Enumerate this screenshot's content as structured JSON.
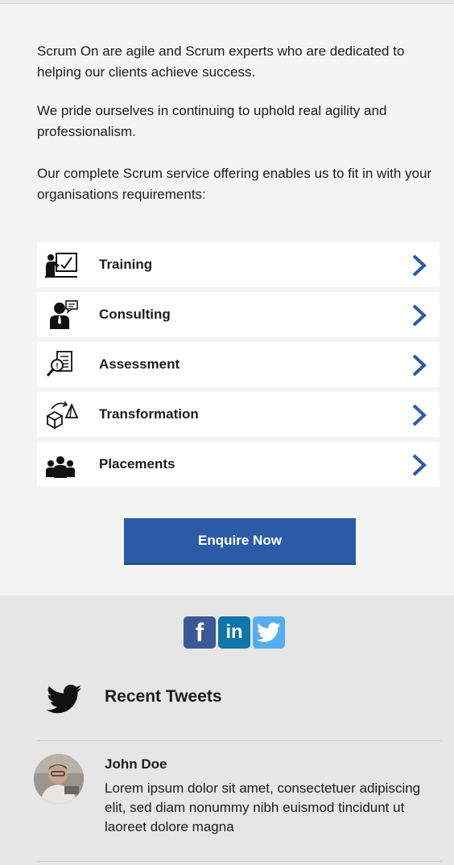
{
  "intro": {
    "p1": "Scrum On are agile and Scrum experts who are dedicated to helping our clients achieve success.",
    "p2": "We pride ourselves in continuing to uphold real agility and professionalism.",
    "p3": "Our complete Scrum service offering enables us to fit in with your organisations requirements:"
  },
  "services": [
    {
      "label": "Training",
      "icon": "training-icon"
    },
    {
      "label": "Consulting",
      "icon": "consulting-icon"
    },
    {
      "label": "Assessment",
      "icon": "assessment-icon"
    },
    {
      "label": "Transformation",
      "icon": "transformation-icon"
    },
    {
      "label": "Placements",
      "icon": "placements-icon"
    }
  ],
  "cta": {
    "label": "Enquire Now"
  },
  "social": {
    "facebook": "f",
    "linkedin": "in",
    "colors": {
      "facebook": "#3b5998",
      "linkedin": "#0e76a8",
      "twitter": "#55acee"
    }
  },
  "tweets": {
    "heading": "Recent Tweets",
    "items": [
      {
        "name": "John Doe",
        "text": "Lorem ipsum dolor sit amet, consectetuer adipiscing elit, sed diam nonummy nibh euismod tincidunt ut laoreet dolore magna"
      }
    ]
  },
  "colors": {
    "accent": "#2b5ba6",
    "chevron": "#2b5ba6",
    "background": "#f4f4f4",
    "footer": "#e6e6e6"
  }
}
